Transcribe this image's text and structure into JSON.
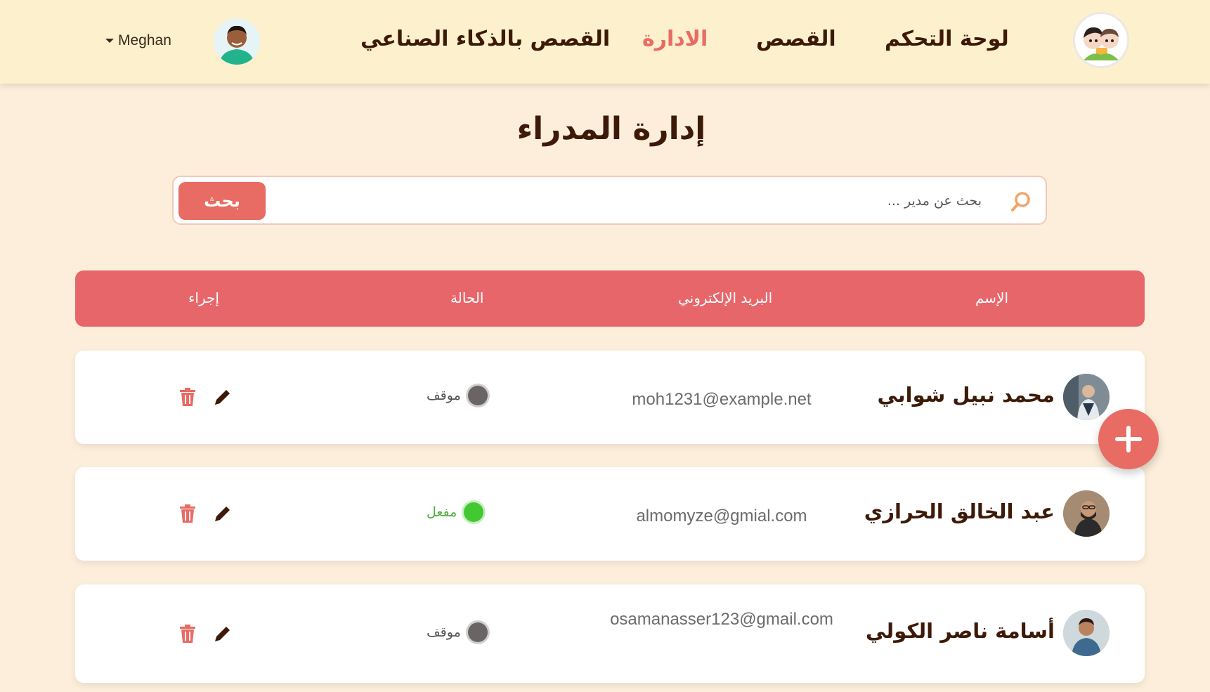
{
  "header": {
    "user_name": "Meghan",
    "nav": [
      {
        "label": "لوحة التحكم",
        "active": false
      },
      {
        "label": "القصص",
        "active": false
      },
      {
        "label": "الادارة",
        "active": true
      },
      {
        "label": "القصص بالذكاء الصناعي",
        "active": false
      }
    ]
  },
  "page_title": "إدارة المدراء",
  "search": {
    "placeholder": "بحث عن مدير ...",
    "value": "",
    "button_label": "بحث"
  },
  "table": {
    "columns": [
      "الإسم",
      "البريد الإلكتروني",
      "الحالة",
      "إجراء"
    ],
    "rows": [
      {
        "name": "محمد نبيل شوابي",
        "email": "moh1231@example.net",
        "status": "موقف",
        "status_color": "#6b6464",
        "status_text_color": "#555555"
      },
      {
        "name": "عبد الخالق الحرازي",
        "email": "almomyze@gmial.com",
        "status": "مفعل",
        "status_color": "#42c832",
        "status_text_color": "#4cae3a"
      },
      {
        "name": "أسامة ناصر الكولي",
        "email": "osamanasser123@gmail.com",
        "status": "موقف",
        "status_color": "#6b6464",
        "status_text_color": "#555555"
      }
    ]
  },
  "icons": {
    "edit": "pencil-icon",
    "delete": "trash-icon",
    "add": "plus-icon",
    "search": "magnifier-icon"
  },
  "colors": {
    "accent": "#e86b64",
    "header_bg": "#fdf1cd",
    "page_bg": "#fdeedb",
    "table_header": "#e6666a",
    "text_dark": "#3d1a08"
  }
}
